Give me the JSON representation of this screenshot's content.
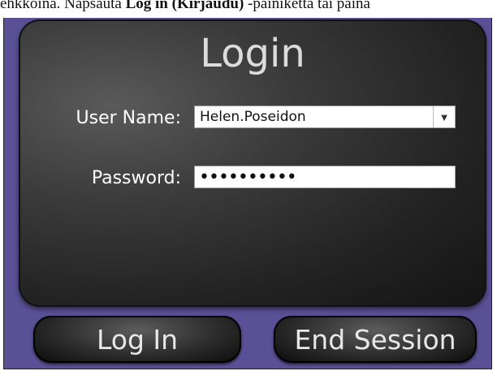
{
  "caption": {
    "prefix": "ehkkoina. Napsauta ",
    "bold": "Log in (Kirjaudu)",
    "suffix": " -painiketta tai paina"
  },
  "login": {
    "title": "Login",
    "username_label": "User Name:",
    "username_value": "Helen.Poseidon",
    "password_label": "Password:",
    "password_value": "••••••••••"
  },
  "buttons": {
    "login": "Log In",
    "end_session": "End Session"
  },
  "colors": {
    "frame_background": "#5a5096",
    "panel": "#2a2a2a",
    "text_light": "#ffffff"
  },
  "icons": {
    "dropdown": "chevron-down-icon"
  }
}
